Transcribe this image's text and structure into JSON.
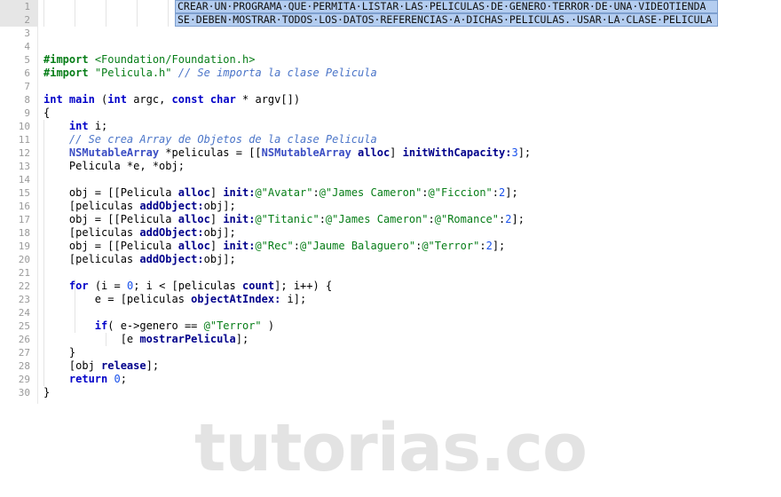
{
  "editor": {
    "language": "Objective-C",
    "first_line": 1,
    "last_line": 30,
    "total_lines": 30,
    "selection_color": "#b4cdf0",
    "selection_border_color": "#7d9fcf",
    "gutter_highlight_color": "#e6e6e6",
    "background_color": "#ffffff"
  },
  "selection": {
    "active": true,
    "lines": [
      1,
      2
    ],
    "line1": "CREAR·UN·PROGRAMA·QUE·PERMITA·LISTAR·LAS·PELICULAS·DE·GENERO·TERROR·DE·UNA·VIDEOTIENDA",
    "line2": "SE·DEBEN·MOSTRAR·TODOS·LOS·DATOS·REFERENCIAS·A·DICHAS·PELICULAS.·USAR·LA·CLASE·PELICULA",
    "line1_plain": "CREAR UN PROGRAMA QUE PERMITA LISTAR LAS PELICULAS DE GENERO TERROR DE UNA VIDEOTIENDA",
    "line2_plain": "SE DEBEN MOSTRAR TODOS LOS DATOS REFERENCIAS A DICHAS PELICULAS. USAR LA CLASE PELICULA"
  },
  "line_numbers": [
    "1",
    "2",
    "3",
    "4",
    "5",
    "6",
    "7",
    "8",
    "9",
    "10",
    "11",
    "12",
    "13",
    "14",
    "15",
    "16",
    "17",
    "18",
    "19",
    "20",
    "21",
    "22",
    "23",
    "24",
    "25",
    "26",
    "27",
    "28",
    "29",
    "30"
  ],
  "code_lines": {
    "l3": "",
    "l4": "",
    "l5": "#import <Foundation/Foundation.h>",
    "l6": "#import \"Pelicula.h\" // Se importa la clase Pelicula",
    "l7": "",
    "l8": "int main (int argc, const char * argv[])",
    "l9": "{",
    "l10": "    int i;",
    "l11": "    // Se crea Array de Objetos de la clase Pelicula",
    "l12": "    NSMutableArray *peliculas = [[NSMutableArray alloc] initWithCapacity:3];",
    "l13": "    Pelicula *e, *obj;",
    "l14": "",
    "l15": "    obj = [[Pelicula alloc] init:@\"Avatar\":@\"James Cameron\":@\"Ficcion\":2];",
    "l16": "    [peliculas addObject:obj];",
    "l17": "    obj = [[Pelicula alloc] init:@\"Titanic\":@\"James Cameron\":@\"Romance\":2];",
    "l18": "    [peliculas addObject:obj];",
    "l19": "    obj = [[Pelicula alloc] init:@\"Rec\":@\"Jaume Balaguero\":@\"Terror\":2];",
    "l20": "    [peliculas addObject:obj];",
    "l21": "",
    "l22": "    for (i = 0; i < [peliculas count]; i++) {",
    "l23": "        e = [peliculas objectAtIndex: i];",
    "l24": "",
    "l25": "        if( e->genero == @\"Terror\" )",
    "l26": "            [e mostrarPelicula];",
    "l27": "    }",
    "l28": "    [obj release];",
    "l29": "    return 0;",
    "l30": "}"
  },
  "tokens": {
    "import_kw": "#import",
    "foundation_header": "<Foundation/Foundation.h>",
    "pelicula_header": "\"Pelicula.h\"",
    "comment_import": "// Se importa la clase Pelicula",
    "comment_array": "// Se crea Array de Objetos de la clase Pelicula",
    "kw_int": "int",
    "kw_const": "const",
    "kw_char": "char",
    "kw_for": "for",
    "kw_if": "if",
    "kw_return": "return",
    "fn_main": "main",
    "params_main": "(int argc, const char * argv[])",
    "class_nsmutablearray": "NSMutableArray",
    "class_pelicula": "Pelicula",
    "method_alloc": "alloc",
    "method_init": "init:",
    "method_initwithcapacity": "initWithCapacity:",
    "method_addobject": "addObject:",
    "method_count": "count",
    "method_objectatindex": "objectAtIndex:",
    "method_mostrarpelicula": "mostrarPelicula",
    "method_release": "release",
    "var_i": "i",
    "var_e": "e",
    "var_obj": "obj",
    "var_peliculas": "peliculas",
    "field_genero": "genero",
    "str_avatar": "@\"Avatar\"",
    "str_james_cameron": "@\"James Cameron\"",
    "str_ficcion": "@\"Ficcion\"",
    "str_titanic": "@\"Titanic\"",
    "str_romance": "@\"Romance\"",
    "str_rec": "@\"Rec\"",
    "str_jaume_balaguero": "@\"Jaume Balaguero\"",
    "str_terror": "@\"Terror\"",
    "num_2": "2",
    "num_3": "3",
    "num_0": "0"
  },
  "movies": [
    {
      "title": "Avatar",
      "director": "James Cameron",
      "genre": "Ficcion",
      "copies": "2"
    },
    {
      "title": "Titanic",
      "director": "James Cameron",
      "genre": "Romance",
      "copies": "2"
    },
    {
      "title": "Rec",
      "director": "Jaume Balaguero",
      "genre": "Terror",
      "copies": "2"
    }
  ],
  "watermark": {
    "text": "tutorias.co",
    "color": "#e3e3e3"
  },
  "syntax_colors": {
    "keyword": "#0000c8",
    "preprocessor": "#067d17",
    "string": "#067d17",
    "comment": "#4a74c8",
    "class": "#3b4ec4",
    "method": "#00008b",
    "number": "#1750eb",
    "plain": "#000000",
    "line_number": "#9a9a9a"
  }
}
